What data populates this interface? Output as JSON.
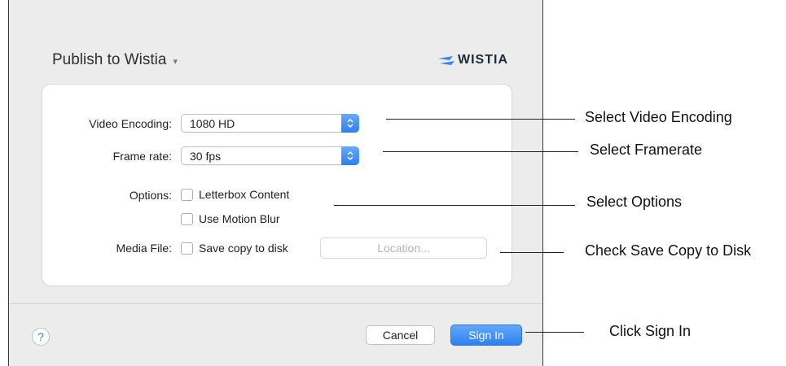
{
  "dialog": {
    "title": "Publish to Wistia",
    "title_caret": "▾",
    "logo_text": "WISTIA",
    "logo_icon": "wistia-logo-icon",
    "accent_color": "#3a86f2"
  },
  "form": {
    "video_encoding": {
      "label": "Video Encoding:",
      "value": "1080 HD"
    },
    "frame_rate": {
      "label": "Frame rate:",
      "value": "30 fps"
    },
    "options": {
      "label": "Options:",
      "letterbox": {
        "label": "Letterbox Content",
        "checked": false
      },
      "motion_blur": {
        "label": "Use Motion Blur",
        "checked": false
      }
    },
    "media_file": {
      "label": "Media File:",
      "save_copy": {
        "label": "Save copy to disk",
        "checked": false
      },
      "location_label": "Location..."
    }
  },
  "footer": {
    "help_label": "?",
    "cancel_label": "Cancel",
    "signin_label": "Sign In"
  },
  "callouts": {
    "encoding": "Select Video Encoding",
    "framerate": "Select Framerate",
    "options": "Select Options",
    "save_copy": "Check Save Copy to Disk",
    "sign_in": "Click Sign In"
  }
}
